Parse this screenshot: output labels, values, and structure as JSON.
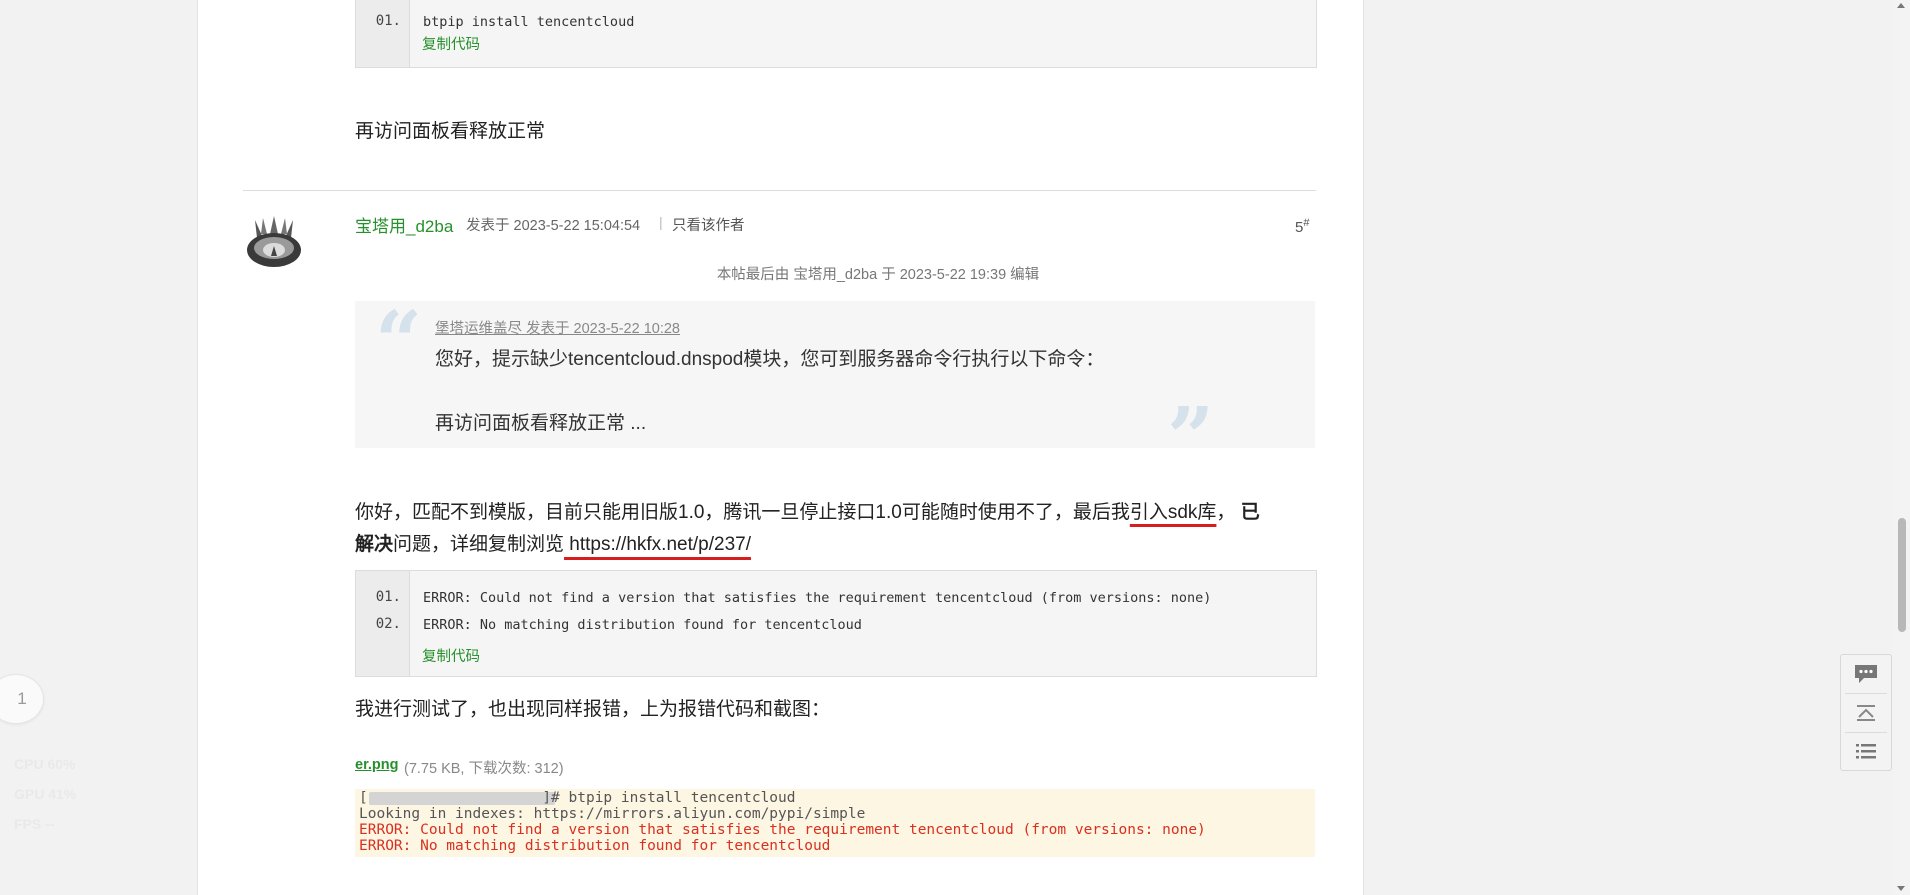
{
  "top_code": {
    "line_numbers": [
      "01."
    ],
    "lines": [
      "btpip install tencentcloud"
    ],
    "copy_label": "复制代码"
  },
  "prev_post_text": "再访问面板看释放正常",
  "post": {
    "author": "宝塔用_d2ba",
    "posted_at": "发表于 2023-5-22 15:04:54",
    "separator": "|",
    "only_author": "只看该作者",
    "floor_number": "5",
    "floor_sign": "#",
    "edit_note": "本帖最后由 宝塔用_d2ba 于 2023-5-22 19:39 编辑",
    "quote": {
      "header": "堡塔运维盖尽 发表于 2023-5-22 10:28",
      "line1": "您好，提示缺少tencentcloud.dnspod模块，您可到服务器命令行执行以下命令：",
      "line2": "再访问面板看释放正常 ..."
    },
    "reply": {
      "part1": "你好，匹配不到模版，目前只能用旧版1.0，腾讯一旦停止接口1.0可能随时使用不了，最后我",
      "highlight": "引入sdk库",
      "comma": "，",
      "bold1": "已",
      "bold2": "解决",
      "part2": "问题，详细复制浏览",
      "link": " https://hkfx.net/p/237/"
    },
    "error_code": {
      "line_numbers": [
        "01.",
        "02."
      ],
      "lines": [
        "ERROR: Could not find a version that satisfies the requirement tencentcloud (from versions: none)",
        "ERROR: No matching distribution found for tencentcloud"
      ],
      "copy_label": "复制代码"
    },
    "test_text": "我进行测试了，也出现同样报错，上为报错代码和截图：",
    "attachment": {
      "name": "er.png",
      "meta": "(7.75 KB, 下载次数: 312)"
    },
    "screenshot": {
      "line0": "[                    ]# btpip install tencentcloud",
      "line1": "Looking in indexes: https://mirrors.aliyun.com/pypi/simple",
      "line2": "ERROR: Could not find a version that satisfies the requirement tencentcloud (from versions: none)",
      "line3": "ERROR: No matching distribution found for tencentcloud"
    }
  },
  "page_badge": "1",
  "perf_overlay": {
    "cpu": "CPU  60%",
    "gpu": "GPU  41%",
    "fps": "FPS  --"
  },
  "side_tools": {
    "reply_icon": "comment-icon",
    "top_icon": "back-to-top-icon",
    "list_icon": "list-icon"
  },
  "colors": {
    "link_green": "#26912c",
    "underline_red": "#d71e1e",
    "error_red": "#d9301f",
    "quote_mark": "#d5e2ec"
  }
}
